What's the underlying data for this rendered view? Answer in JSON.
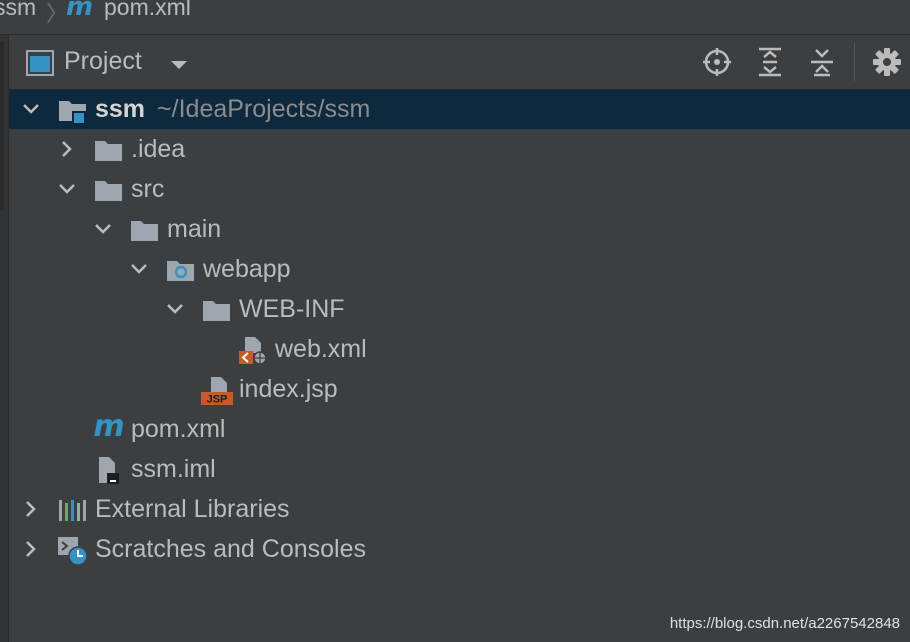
{
  "breadcrumb": {
    "project": "ssm",
    "file_icon": "maven-icon",
    "file": "pom.xml"
  },
  "panel": {
    "title": "Project",
    "actions": [
      "locate-icon",
      "expand-all-icon",
      "collapse-all-icon",
      "gear-icon"
    ]
  },
  "tree": {
    "root_name": "ssm",
    "root_path": "~/IdeaProjects/ssm",
    "idea": ".idea",
    "src": "src",
    "main": "main",
    "webapp": "webapp",
    "webinf": "WEB-INF",
    "webxml": "web.xml",
    "indexjsp": "index.jsp",
    "jsp_badge": "JSP",
    "pom": "pom.xml",
    "iml": "ssm.iml",
    "extlibs": "External Libraries",
    "scratches": "Scratches and Consoles"
  },
  "watermark": "https://blog.csdn.net/a2267542848",
  "colors": {
    "background": "#3c3f41",
    "selection": "#0d293e",
    "text": "#bbbbbb",
    "folder": "#a0a6ad",
    "maven": "#3592c4",
    "jsp_badge": "#c25c2a"
  }
}
